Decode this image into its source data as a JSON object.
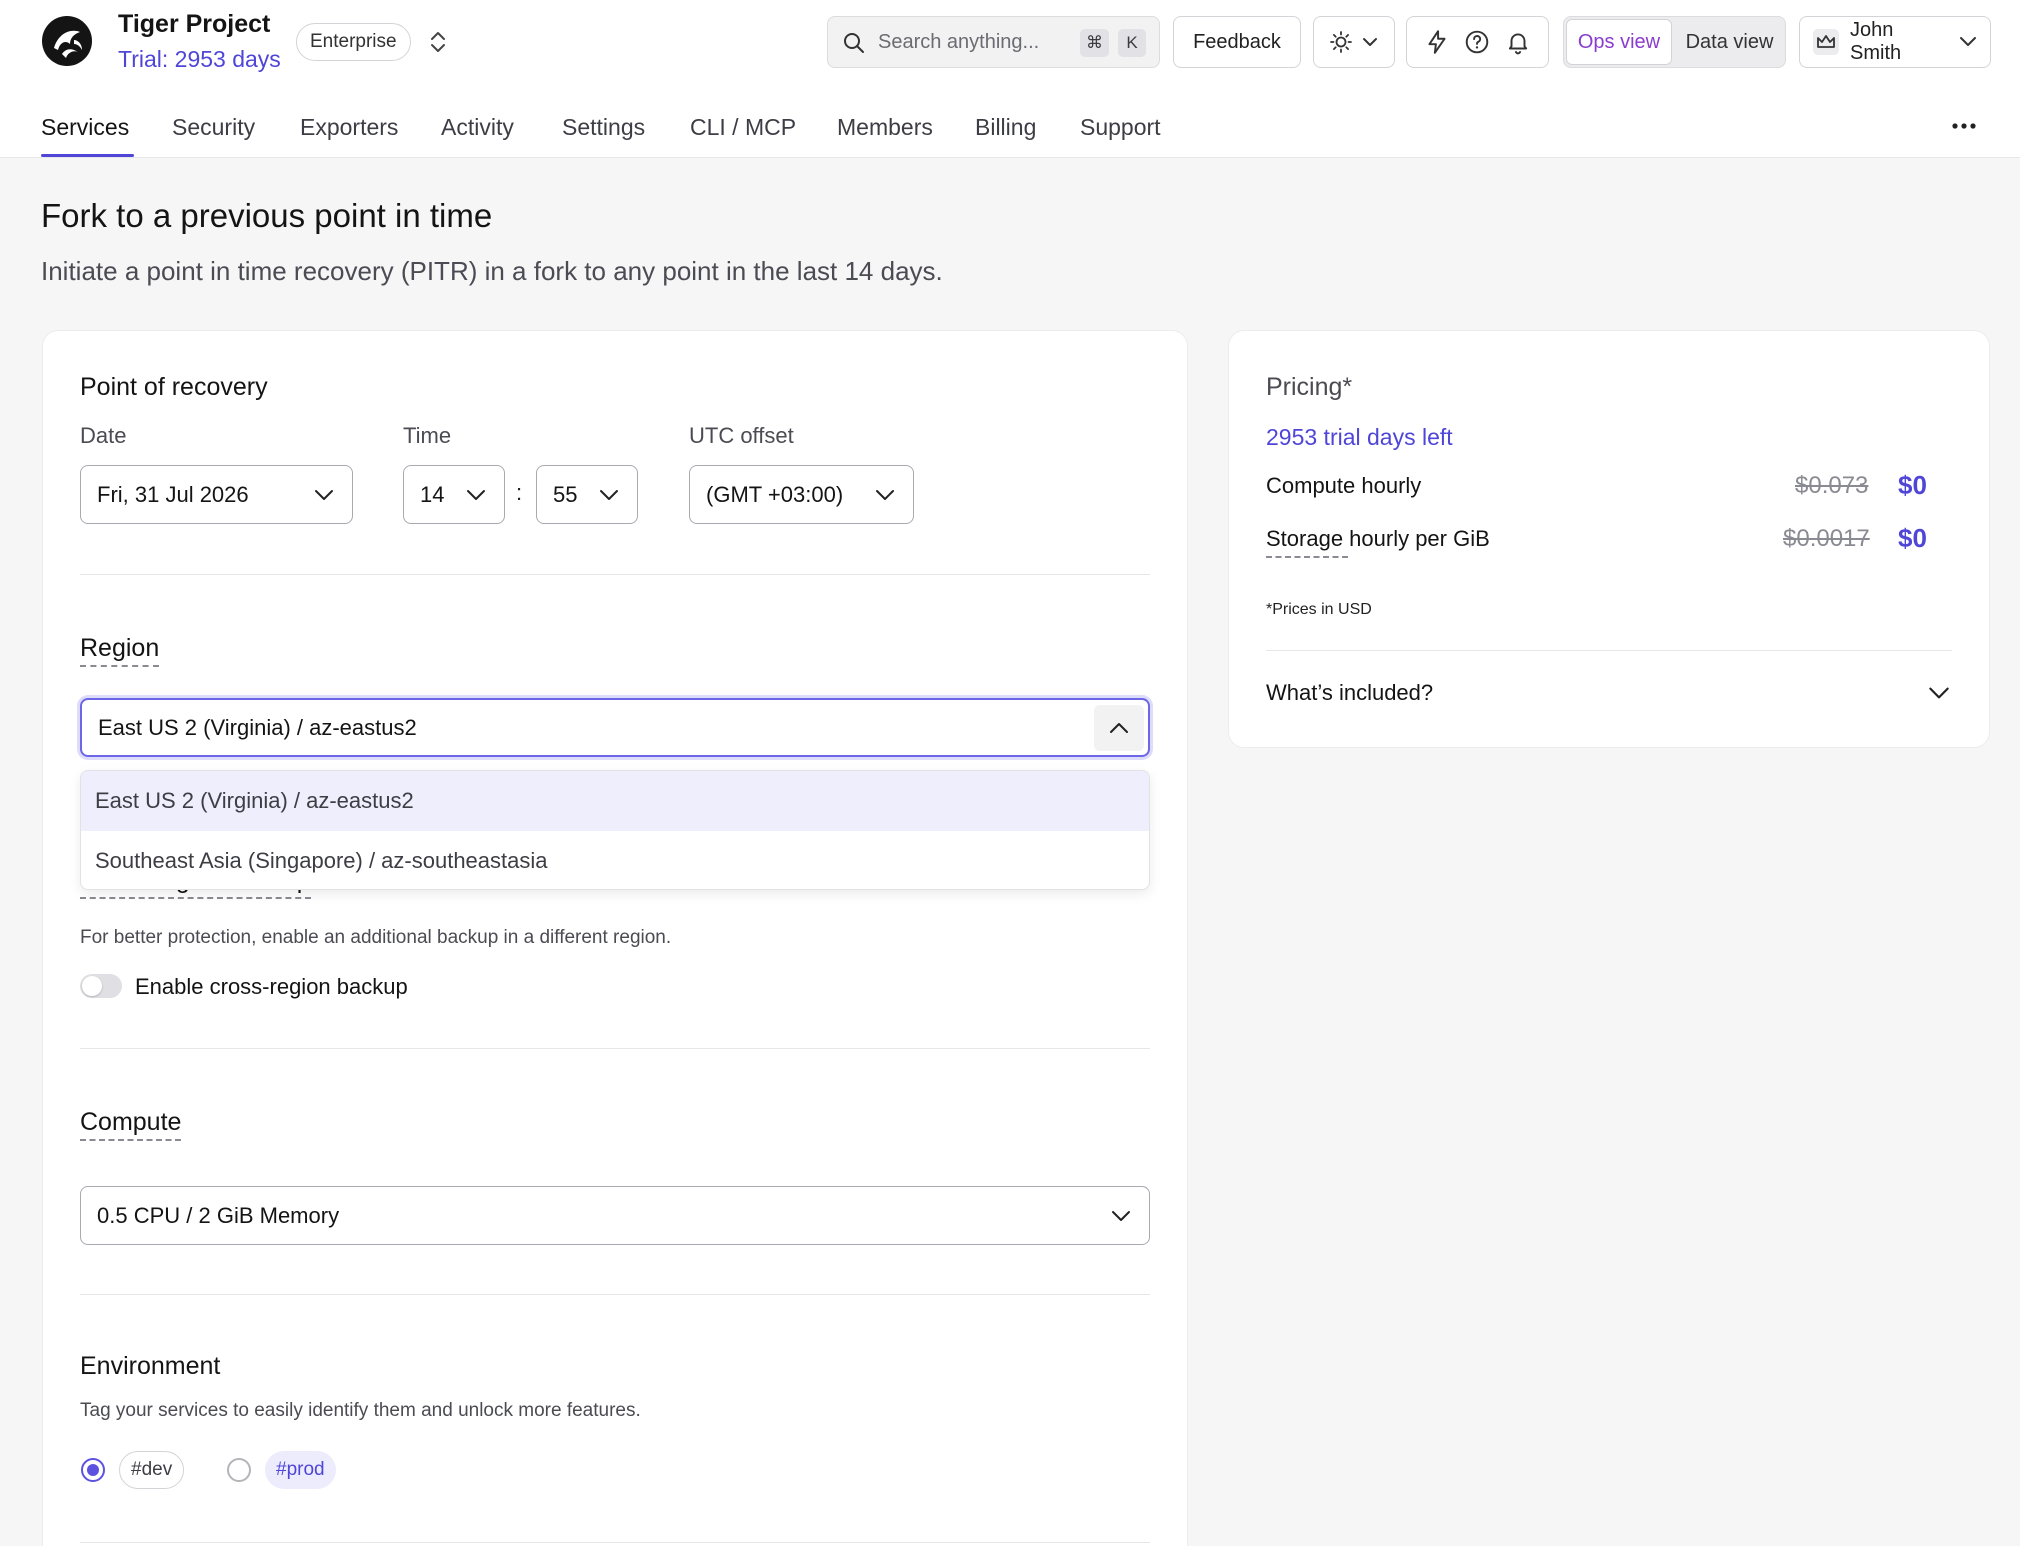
{
  "header": {
    "project_name": "Tiger Project",
    "trial_text": "Trial: 2953 days",
    "plan_badge": "Enterprise",
    "search_placeholder": "Search anything...",
    "search_kbd_1": "⌘",
    "search_kbd_2": "K",
    "feedback_label": "Feedback",
    "ops_view_label": "Ops view",
    "data_view_label": "Data view",
    "user_name": "John Smith"
  },
  "tabs": [
    {
      "label": "Services"
    },
    {
      "label": "Security"
    },
    {
      "label": "Exporters"
    },
    {
      "label": "Activity"
    },
    {
      "label": "Settings"
    },
    {
      "label": "CLI / MCP"
    },
    {
      "label": "Members"
    },
    {
      "label": "Billing"
    },
    {
      "label": "Support"
    }
  ],
  "page": {
    "title": "Fork to a previous point in time",
    "subtitle": "Initiate a point in time recovery (PITR) in a fork to any point in the last 14 days."
  },
  "recovery": {
    "title": "Point of recovery",
    "date_label": "Date",
    "date_value": "Fri, 31 Jul 2026",
    "time_label": "Time",
    "hour_value": "14",
    "time_sep": ":",
    "minute_value": "55",
    "utc_label": "UTC offset",
    "utc_value": "(GMT +03:00)"
  },
  "region": {
    "title": "Region",
    "selected": "East US 2 (Virginia) / az-eastus2",
    "options": [
      {
        "label": "East US 2 (Virginia) / az-eastus2"
      },
      {
        "label": "Southeast Asia (Singapore) / az-southeastasia"
      }
    ]
  },
  "backup": {
    "title": "Cross-region backup",
    "description": "For better protection, enable an additional backup in a different region.",
    "toggle_label": "Enable cross-region backup"
  },
  "compute": {
    "title": "Compute",
    "selected": "0.5 CPU / 2 GiB Memory"
  },
  "environment": {
    "title": "Environment",
    "description": "Tag your services to easily identify them and unlock more features.",
    "options": [
      {
        "label": "#dev"
      },
      {
        "label": "#prod"
      }
    ]
  },
  "pricing": {
    "title": "Pricing*",
    "trial_left": "2953 trial days left",
    "compute_label": "Compute hourly",
    "compute_old": "$0.073",
    "compute_new": "$0",
    "storage_label": "Storage hourly per GiB",
    "storage_old": "$0.0017",
    "storage_new": "$0",
    "note": "*Prices in USD",
    "included_label": "What’s included?"
  },
  "colors": {
    "accent": "#4f46d8",
    "ops_view": "#8a3ccf"
  }
}
